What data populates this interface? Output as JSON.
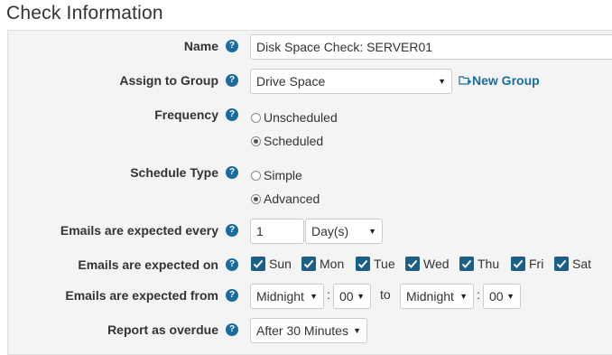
{
  "title": "Check Information",
  "help_glyph": "?",
  "name": {
    "label": "Name",
    "value": "Disk Space Check: SERVER01"
  },
  "group": {
    "label": "Assign to Group",
    "value": "Drive Space",
    "new_group_label": "New Group"
  },
  "frequency": {
    "label": "Frequency",
    "options": [
      "Unscheduled",
      "Scheduled"
    ],
    "selected": "Scheduled"
  },
  "schedule_type": {
    "label": "Schedule Type",
    "options": [
      "Simple",
      "Advanced"
    ],
    "selected": "Advanced"
  },
  "expected_every": {
    "label": "Emails are expected every",
    "value": "1",
    "unit": "Day(s)"
  },
  "expected_on": {
    "label": "Emails are expected on",
    "days": [
      {
        "label": "Sun",
        "checked": true
      },
      {
        "label": "Mon",
        "checked": true
      },
      {
        "label": "Tue",
        "checked": true
      },
      {
        "label": "Wed",
        "checked": true
      },
      {
        "label": "Thu",
        "checked": true
      },
      {
        "label": "Fri",
        "checked": true
      },
      {
        "label": "Sat",
        "checked": true
      }
    ]
  },
  "expected_from": {
    "label": "Emails are expected from",
    "from_hour": "Midnight",
    "from_minute": "00",
    "to_word": "to",
    "colon": ":",
    "to_hour": "Midnight",
    "to_minute": "00"
  },
  "overdue": {
    "label": "Report as overdue",
    "value": "After 30 Minutes"
  },
  "caret_glyph": "▼",
  "colors": {
    "accent": "#1a6b9e",
    "checkbox": "#1a5f86",
    "panel": "#f4f4f4"
  }
}
